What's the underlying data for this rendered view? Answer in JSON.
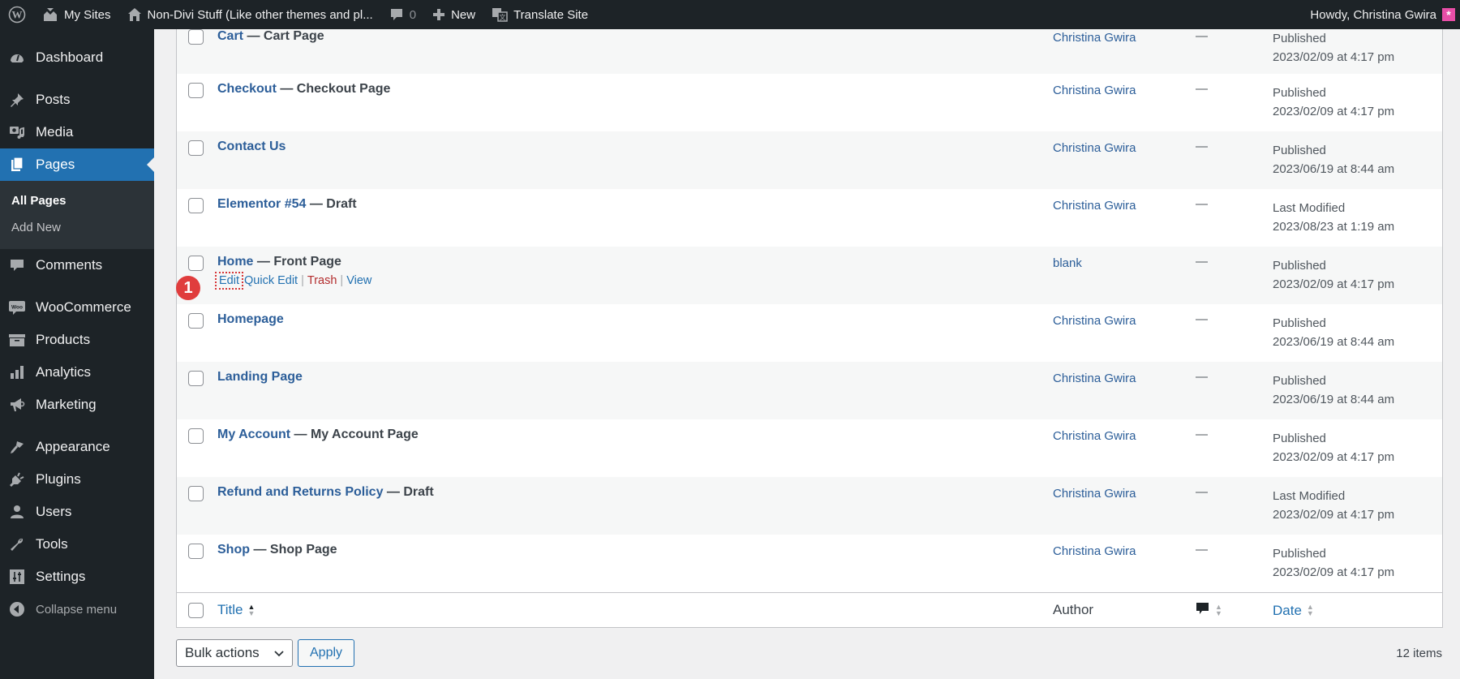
{
  "adminbar": {
    "my_sites": "My Sites",
    "site_name": "Non-Divi Stuff (Like other themes and pl...",
    "comments_count": "0",
    "new": "New",
    "translate": "Translate Site",
    "howdy": "Howdy, Christina Gwira"
  },
  "sidebar": {
    "items": [
      {
        "label": "Dashboard",
        "icon": "dashboard-icon"
      },
      {
        "label": "Posts",
        "icon": "pin-icon"
      },
      {
        "label": "Media",
        "icon": "media-icon"
      },
      {
        "label": "Pages",
        "icon": "pages-icon"
      },
      {
        "label": "Comments",
        "icon": "comment-icon"
      },
      {
        "label": "WooCommerce",
        "icon": "woo-icon"
      },
      {
        "label": "Products",
        "icon": "archive-icon"
      },
      {
        "label": "Analytics",
        "icon": "chart-icon"
      },
      {
        "label": "Marketing",
        "icon": "megaphone-icon"
      },
      {
        "label": "Appearance",
        "icon": "brush-icon"
      },
      {
        "label": "Plugins",
        "icon": "plug-icon"
      },
      {
        "label": "Users",
        "icon": "user-icon"
      },
      {
        "label": "Tools",
        "icon": "wrench-icon"
      },
      {
        "label": "Settings",
        "icon": "sliders-icon"
      }
    ],
    "submenu": [
      "All Pages",
      "Add New"
    ],
    "collapse": "Collapse menu"
  },
  "table": {
    "rows": [
      {
        "title": "Cart",
        "state": "— Cart Page",
        "author": "Christina Gwira",
        "comments": "—",
        "status": "Published",
        "date": "2023/02/09 at 4:17 pm"
      },
      {
        "title": "Checkout",
        "state": "— Checkout Page",
        "author": "Christina Gwira",
        "comments": "—",
        "status": "Published",
        "date": "2023/02/09 at 4:17 pm"
      },
      {
        "title": "Contact Us",
        "state": "",
        "author": "Christina Gwira",
        "comments": "—",
        "status": "Published",
        "date": "2023/06/19 at 8:44 am"
      },
      {
        "title": "Elementor #54",
        "state": "— Draft",
        "author": "Christina Gwira",
        "comments": "—",
        "status": "Last Modified",
        "date": "2023/08/23 at 1:19 am"
      },
      {
        "title": "Home",
        "state": "— Front Page",
        "author": "blank",
        "comments": "—",
        "status": "Published",
        "date": "2023/02/09 at 4:17 pm"
      },
      {
        "title": "Homepage",
        "state": "",
        "author": "Christina Gwira",
        "comments": "—",
        "status": "Published",
        "date": "2023/06/19 at 8:44 am"
      },
      {
        "title": "Landing Page",
        "state": "",
        "author": "Christina Gwira",
        "comments": "—",
        "status": "Published",
        "date": "2023/06/19 at 8:44 am"
      },
      {
        "title": "My Account",
        "state": "— My Account Page",
        "author": "Christina Gwira",
        "comments": "—",
        "status": "Published",
        "date": "2023/02/09 at 4:17 pm"
      },
      {
        "title": "Refund and Returns Policy",
        "state": "— Draft",
        "author": "Christina Gwira",
        "comments": "—",
        "status": "Last Modified",
        "date": "2023/02/09 at 4:17 pm"
      },
      {
        "title": "Shop",
        "state": "— Shop Page",
        "author": "Christina Gwira",
        "comments": "—",
        "status": "Published",
        "date": "2023/02/09 at 4:17 pm"
      }
    ],
    "row_actions": {
      "edit": "Edit",
      "quick_edit": "Quick Edit",
      "trash": "Trash",
      "view": "View",
      "sep": "|"
    },
    "annotation_badge": "1",
    "footer": {
      "title": "Title",
      "author": "Author",
      "date": "Date"
    }
  },
  "tablenav": {
    "bulk_actions": "Bulk actions",
    "apply": "Apply",
    "items_count": "12 items"
  }
}
